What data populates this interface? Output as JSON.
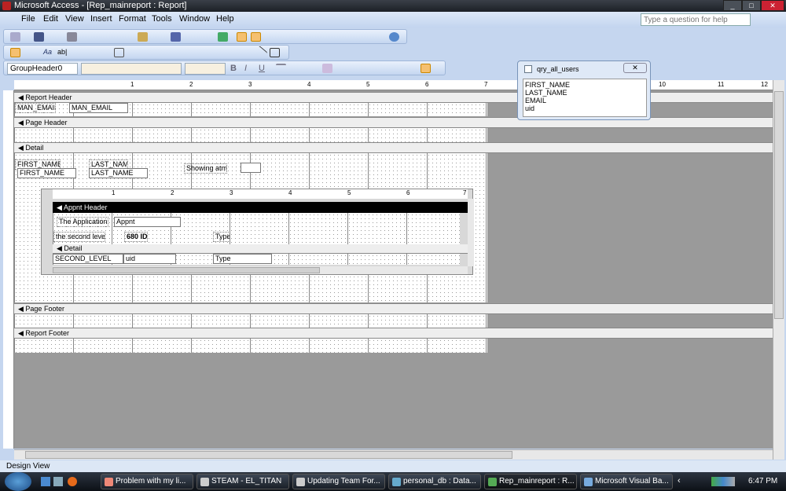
{
  "window": {
    "title": "Microsoft Access - [Rep_mainreport : Report]"
  },
  "menu": [
    "File",
    "Edit",
    "View",
    "Insert",
    "Format",
    "Tools",
    "Window",
    "Help"
  ],
  "help_placeholder": "Type a question for help",
  "format_bar": {
    "object": "GroupHeader0",
    "font": "",
    "size": "",
    "bold": "B",
    "italic": "I",
    "underline": "U"
  },
  "ruler": [
    "1",
    "2",
    "3",
    "4",
    "5",
    "6",
    "7",
    "8",
    "9",
    "10",
    "11",
    "12"
  ],
  "sections": {
    "report_header": "Report Header",
    "page_header": "Page Header",
    "detail": "Detail",
    "page_footer": "Page Footer",
    "report_footer": "Report Footer"
  },
  "controls": {
    "man_email_label": "MAN_EMAIL:",
    "man_email": "MAN_EMAIL",
    "first_name_label": "FIRST_NAME:",
    "first_name": "FIRST_NAME",
    "last_name_label": "LAST_NAME:",
    "last_name": "LAST_NAME",
    "showing_label": "Showing atm:"
  },
  "subreport": {
    "ruler": [
      "1",
      "2",
      "3",
      "4",
      "5",
      "6",
      "7"
    ],
    "header": "Appnt Header",
    "app_label": "The Application:",
    "app_field": "Appnt",
    "second_label": "the second level",
    "id_label": "680 ID",
    "type_label": "Type",
    "detail": "Detail",
    "second_field": "SECOND_LEVEL",
    "uid_field": "uid",
    "type_field": "Type"
  },
  "field_list": {
    "title": "qry_all_users",
    "fields": [
      "FIRST_NAME",
      "LAST_NAME",
      "EMAIL",
      "uid"
    ]
  },
  "status": "Design View",
  "taskbar": {
    "tasks": [
      "Problem with my li...",
      "STEAM - EL_TITAN",
      "Updating Team For...",
      "personal_db : Data...",
      "Rep_mainreport : R...",
      "Microsoft Visual Ba..."
    ],
    "clock": "6:47 PM"
  }
}
